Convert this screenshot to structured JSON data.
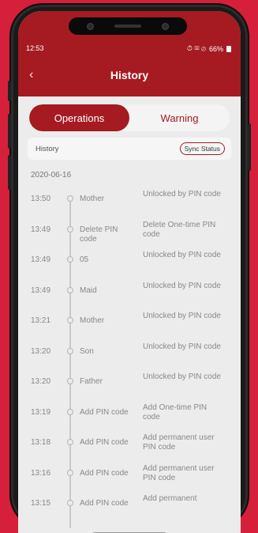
{
  "status": {
    "time": "12:53",
    "icons": "⏱ ✉ ⊘",
    "battery": "66%"
  },
  "header": {
    "back_icon": "chevron-left-icon",
    "title": "History"
  },
  "tabs": [
    {
      "label": "Operations",
      "active": true
    },
    {
      "label": "Warning",
      "active": false
    }
  ],
  "history_bar": {
    "label": "History",
    "sync_label": "Sync Status"
  },
  "date": "2020-06-16",
  "records": [
    {
      "time": "13:50",
      "who": "Mother",
      "action": "Unlocked by PIN code"
    },
    {
      "time": "13:49",
      "who": "Delete PIN code",
      "action": "Delete One-time PIN code"
    },
    {
      "time": "13:49",
      "who": "05",
      "action": "Unlocked by PIN code"
    },
    {
      "time": "13:49",
      "who": "Maid",
      "action": "Unlocked by PIN code"
    },
    {
      "time": "13:21",
      "who": "Mother",
      "action": "Unlocked by PIN code"
    },
    {
      "time": "13:20",
      "who": "Son",
      "action": "Unlocked by PIN code"
    },
    {
      "time": "13:20",
      "who": "Father",
      "action": "Unlocked by PIN code"
    },
    {
      "time": "13:19",
      "who": "Add PIN code",
      "action": "Add One-time PIN code"
    },
    {
      "time": "13:18",
      "who": "Add PIN code",
      "action": "Add permanent user PIN code"
    },
    {
      "time": "13:16",
      "who": "Add PIN code",
      "action": "Add permanent user PIN code"
    },
    {
      "time": "13:15",
      "who": "Add PIN code",
      "action": "Add permanent"
    }
  ],
  "colors": {
    "brand": "#a51b21",
    "background": "#d51f3b"
  }
}
